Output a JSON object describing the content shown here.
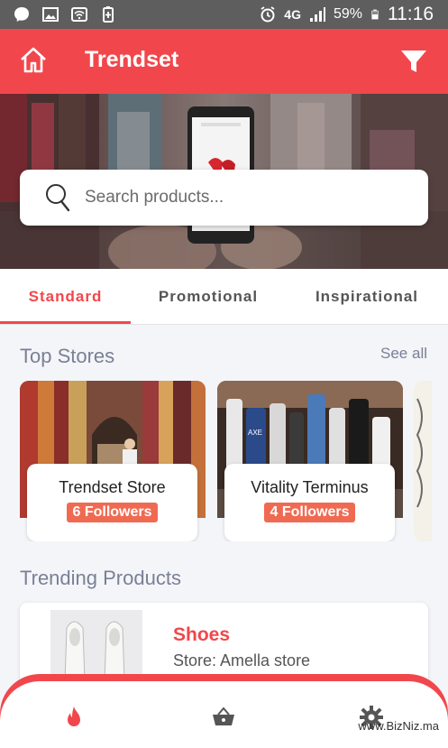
{
  "status_bar": {
    "network": "4G",
    "battery": "59%",
    "time": "11:16",
    "left_icons": [
      "messenger-icon",
      "gallery-icon",
      "wifi-icon",
      "battery-saver-icon"
    ],
    "right_icons": [
      "alarm-icon",
      "signal-icon",
      "battery-icon"
    ]
  },
  "app_bar": {
    "title": "Trendset",
    "home_icon": "home-icon",
    "filter_icon": "filter-icon",
    "color": "#f1474c"
  },
  "search": {
    "placeholder": "Search products...",
    "icon": "search-icon"
  },
  "tabs": [
    {
      "label": "Standard",
      "active": true
    },
    {
      "label": "Promotional",
      "active": false
    },
    {
      "label": "Inspirational",
      "active": false
    }
  ],
  "top_stores": {
    "title": "Top Stores",
    "see_all": "See all",
    "stores": [
      {
        "name": "Trendset Store",
        "followers": "6 Followers"
      },
      {
        "name": "Vitality Terminus",
        "followers": "4 Followers"
      }
    ]
  },
  "trending": {
    "title": "Trending Products",
    "products": [
      {
        "name": "Shoes",
        "store": "Store: Amella store"
      }
    ]
  },
  "bottom_nav": {
    "items": [
      {
        "icon": "flame-icon",
        "active": true
      },
      {
        "icon": "basket-icon",
        "active": false
      },
      {
        "icon": "gear-icon",
        "active": false
      }
    ]
  },
  "watermark": "www.BizNiz.ma",
  "colors": {
    "accent": "#f1474c",
    "badge": "#f06a52",
    "section_text": "#7a8095"
  }
}
